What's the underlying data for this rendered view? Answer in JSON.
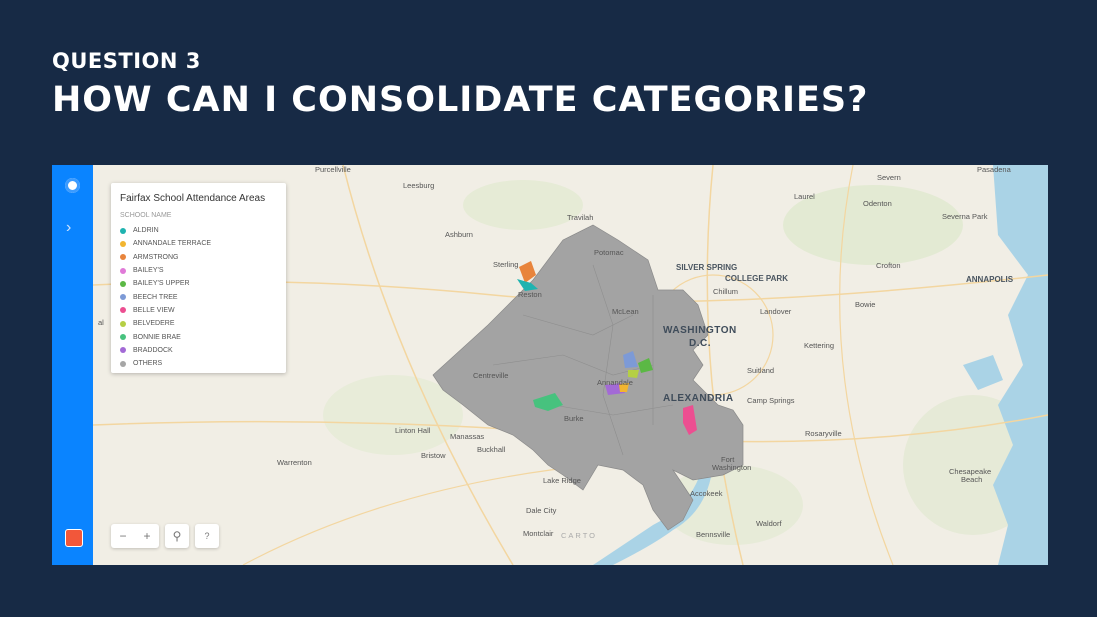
{
  "slide": {
    "eyebrow": "QUESTION 3",
    "title": "HOW CAN I CONSOLIDATE CATEGORIES?"
  },
  "legend": {
    "title": "Fairfax School Attendance Areas",
    "subtitle": "SCHOOL NAME",
    "items": [
      {
        "label": "ALDRIN",
        "color": "#1fb3b0"
      },
      {
        "label": "ANNANDALE TERRACE",
        "color": "#f2b530"
      },
      {
        "label": "ARMSTRONG",
        "color": "#e8843c"
      },
      {
        "label": "BAILEY'S",
        "color": "#e07ad8"
      },
      {
        "label": "BAILEY'S UPPER",
        "color": "#5bb845"
      },
      {
        "label": "BEECH TREE",
        "color": "#7d9ad6"
      },
      {
        "label": "BELLE VIEW",
        "color": "#ec4f91"
      },
      {
        "label": "BELVEDERE",
        "color": "#b5cf45"
      },
      {
        "label": "BONNIE BRAE",
        "color": "#47c27e"
      },
      {
        "label": "BRADDOCK",
        "color": "#a36ad6"
      },
      {
        "label": "OTHERS",
        "color": "#a6a6a6"
      }
    ]
  },
  "controls": {
    "zoom_out": "−",
    "zoom_in": "+",
    "search": "⚲",
    "help": "?"
  },
  "map_labels": [
    {
      "text": "Purcellville",
      "cls": ""
    },
    {
      "text": "Leesburg",
      "cls": ""
    },
    {
      "text": "Laurel",
      "cls": ""
    },
    {
      "text": "Severn",
      "cls": ""
    },
    {
      "text": "Pasadena",
      "cls": ""
    },
    {
      "text": "Odenton",
      "cls": ""
    },
    {
      "text": "Severna Park",
      "cls": ""
    },
    {
      "text": "Travilah",
      "cls": ""
    },
    {
      "text": "Ashburn",
      "cls": ""
    },
    {
      "text": "Potomac",
      "cls": ""
    },
    {
      "text": "Sterling",
      "cls": ""
    },
    {
      "text": "Reston",
      "cls": ""
    },
    {
      "text": "SILVER SPRING",
      "cls": "mid"
    },
    {
      "text": "COLLEGE PARK",
      "cls": "mid"
    },
    {
      "text": "Chillum",
      "cls": ""
    },
    {
      "text": "Crofton",
      "cls": ""
    },
    {
      "text": "ANNAPOLIS",
      "cls": "mid"
    },
    {
      "text": "Bowie",
      "cls": ""
    },
    {
      "text": "McLean",
      "cls": ""
    },
    {
      "text": "Landover",
      "cls": ""
    },
    {
      "text": "WASHINGTON",
      "cls": "big"
    },
    {
      "text": "D.C.",
      "cls": "big"
    },
    {
      "text": "Kettering",
      "cls": ""
    },
    {
      "text": "Centreville",
      "cls": ""
    },
    {
      "text": "Annandale",
      "cls": ""
    },
    {
      "text": "Suitland",
      "cls": ""
    },
    {
      "text": "ALEXANDRIA",
      "cls": "big"
    },
    {
      "text": "Camp Springs",
      "cls": ""
    },
    {
      "text": "Burke",
      "cls": ""
    },
    {
      "text": "Linton Hall",
      "cls": ""
    },
    {
      "text": "Manassas",
      "cls": ""
    },
    {
      "text": "Rosaryville",
      "cls": ""
    },
    {
      "text": "Bristow",
      "cls": ""
    },
    {
      "text": "Buckhall",
      "cls": ""
    },
    {
      "text": "Fort",
      "cls": ""
    },
    {
      "text": "Washington",
      "cls": ""
    },
    {
      "text": "Warrenton",
      "cls": ""
    },
    {
      "text": "Lake Ridge",
      "cls": ""
    },
    {
      "text": "Chesapeake",
      "cls": ""
    },
    {
      "text": "Beach",
      "cls": ""
    },
    {
      "text": "Accokeek",
      "cls": ""
    },
    {
      "text": "Dale City",
      "cls": ""
    },
    {
      "text": "Waldorf",
      "cls": ""
    },
    {
      "text": "Montclair",
      "cls": ""
    },
    {
      "text": "CARTO",
      "cls": ""
    },
    {
      "text": "Bennsville",
      "cls": ""
    },
    {
      "text": "al",
      "cls": ""
    }
  ]
}
